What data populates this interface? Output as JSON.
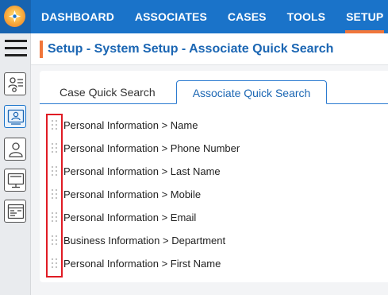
{
  "app": {
    "logo": "app-logo",
    "colors": {
      "nav_bg": "#1a73c9",
      "accent": "#f0763b",
      "title": "#1b66b3"
    }
  },
  "nav": {
    "items": [
      {
        "label": "DASHBOARD"
      },
      {
        "label": "ASSOCIATES"
      },
      {
        "label": "CASES"
      },
      {
        "label": "TOOLS"
      },
      {
        "label": "SETUP",
        "active": true
      }
    ]
  },
  "sidebar": {
    "menu_icon": "hamburger-menu-icon",
    "items": [
      {
        "icon": "person-settings-icon"
      },
      {
        "icon": "person-search-icon",
        "active": true
      },
      {
        "icon": "person-icon"
      },
      {
        "icon": "monitor-icon"
      },
      {
        "icon": "browser-window-icon"
      }
    ]
  },
  "header": {
    "title": "Setup - System Setup - Associate Quick Search"
  },
  "tabs": [
    {
      "label": "Case Quick Search"
    },
    {
      "label": "Associate Quick Search",
      "active": true
    }
  ],
  "fields": [
    {
      "label": "Personal Information > Name"
    },
    {
      "label": "Personal Information > Phone Number"
    },
    {
      "label": "Personal Information > Last Name"
    },
    {
      "label": "Personal Information > Mobile"
    },
    {
      "label": "Personal Information > Email"
    },
    {
      "label": "Business Information > Department"
    },
    {
      "label": "Personal Information > First Name"
    }
  ]
}
